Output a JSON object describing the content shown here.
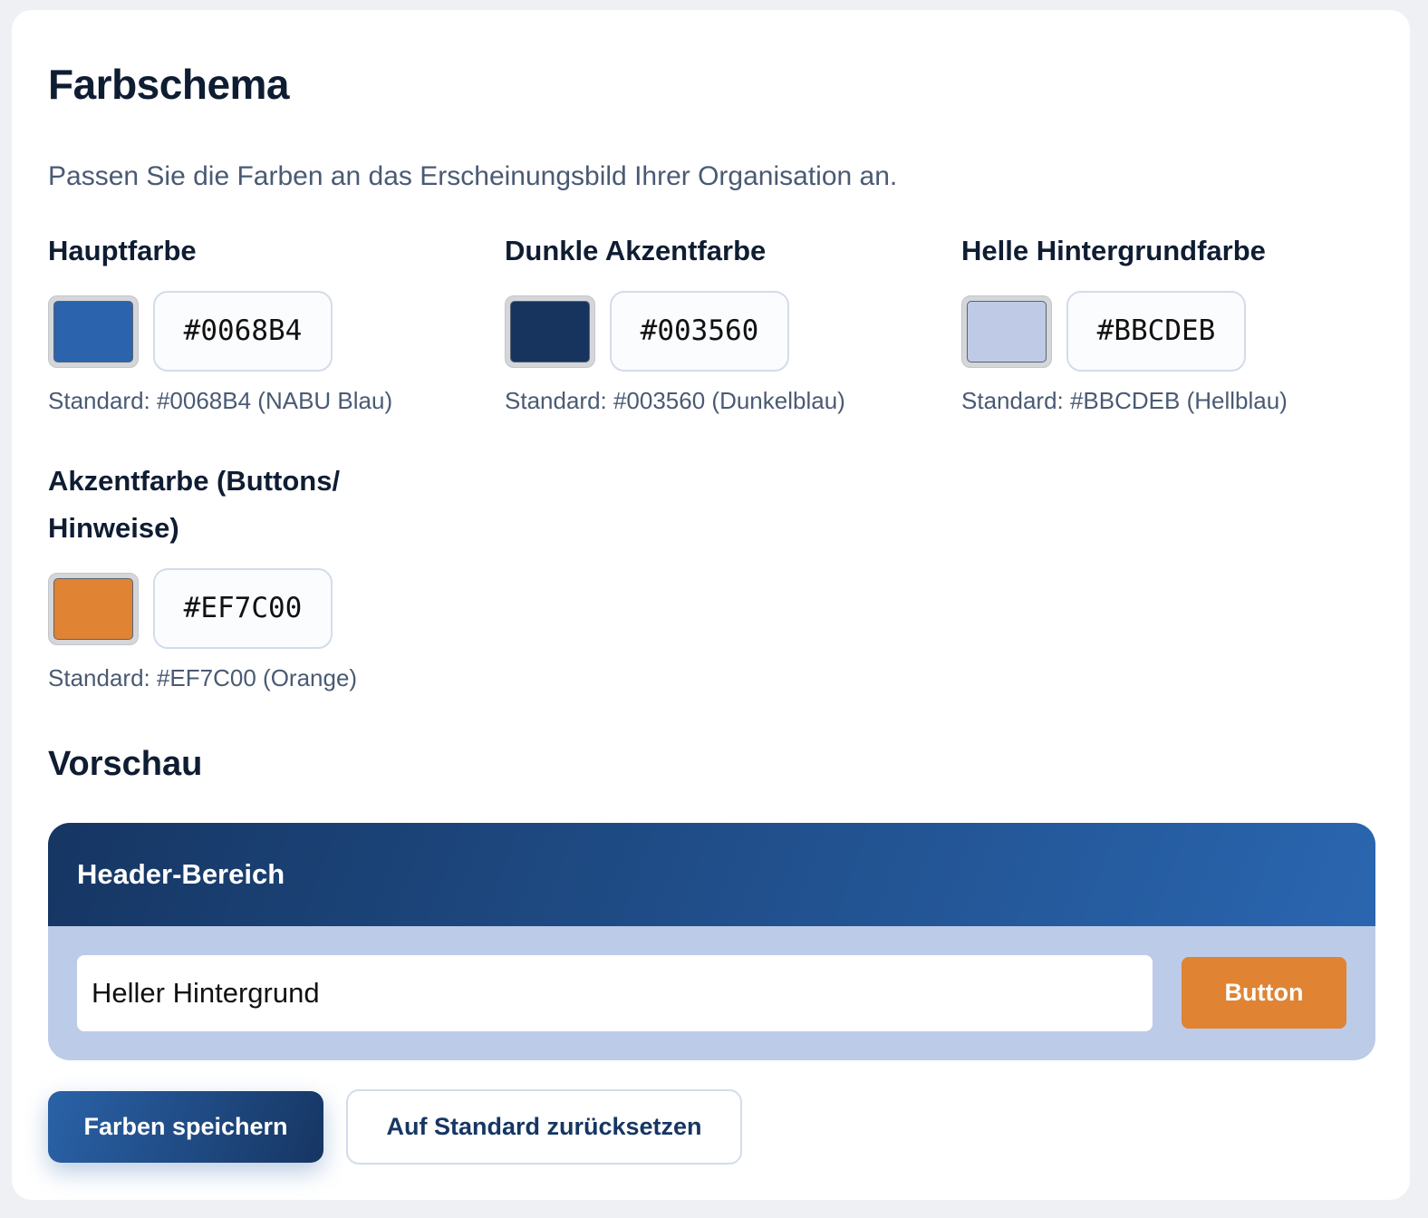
{
  "title": "Farbschema",
  "description": "Passen Sie die Farben an das Erscheinungsbild Ihrer Organisation an.",
  "fields": [
    {
      "label": "Hauptfarbe",
      "value": "#0068B4",
      "swatch": "#2b63ad",
      "hint": "Standard: #0068B4 (NABU Blau)"
    },
    {
      "label": "Dunkle Akzentfarbe",
      "value": "#003560",
      "swatch": "#16345e",
      "hint": "Standard: #003560 (Dunkelblau)"
    },
    {
      "label": "Helle Hintergrundfarbe",
      "value": "#BBCDEB",
      "swatch": "#bfcbe6",
      "hint": "Standard: #BBCDEB (Hellblau)"
    },
    {
      "label_line1": "Akzentfarbe (Buttons/",
      "label_line2": "Hinweise)",
      "value": "#EF7C00",
      "swatch": "#e08332",
      "hint": "Standard: #EF7C00 (Orange)"
    }
  ],
  "preview": {
    "title": "Vorschau",
    "header_text": "Header-Bereich",
    "light_text": "Heller Hintergrund",
    "button_label": "Button"
  },
  "actions": {
    "save_label": "Farben speichern",
    "reset_label": "Auf Standard zurücksetzen"
  }
}
